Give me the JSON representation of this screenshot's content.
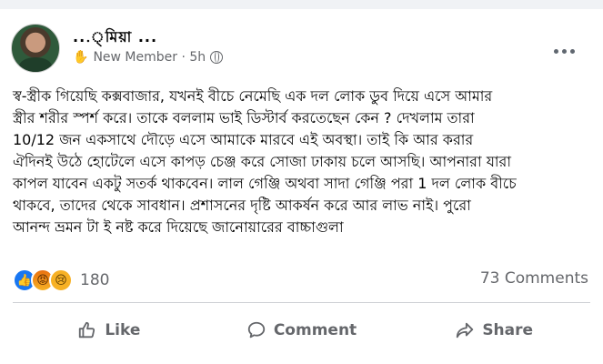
{
  "post": {
    "author_name": "...্মিয়া ...",
    "author_badge": "New Member · 5h",
    "body_lines": [
      "স্ব-স্ত্রীক গিয়েছি কক্সবাজার, যখনই বীচে নেমেছি এক দল লোক ডুব দিয়ে এসে আমার",
      "স্ত্রীর শরীর স্পর্শ করে। তাকে বললাম ভাই ডিস্টার্ব করতেছেন কেন ?  দেখলাম তারা",
      "10/12 জন একসাথে দৌড়ে এসে আমাকে মারবে এই অবস্থা।  তাই কি আর করার",
      "ঐদিনই উঠে হোটেলে এসে কাপড় চেঞ্জ করে সোজা ঢাকায় চলে আসছি। আপনারা যারা",
      "কাপল যাবেন একটু সতর্ক থাকবেন।  লাল গেঞ্জি অথবা সাদা গেঞ্জি পরা 1 দল লোক বীচে",
      "থাকবে,  তাদের থেকে সাবধান। প্রশাসনের দৃষ্টি আকর্ষন করে আর লাভ নাই।  পুরো",
      "আনন্দ ভ্রমন টা ই নষ্ট করে দিয়েছে জানোয়ারের বাচ্চাগুলা"
    ]
  },
  "reactions": {
    "icons": [
      "like-icon",
      "angry-icon",
      "sad-icon"
    ],
    "count": "180"
  },
  "comments_label": "73 Comments",
  "actions": {
    "like": "Like",
    "comment": "Comment",
    "share": "Share"
  },
  "colors": {
    "like_blue": "#1877f2",
    "secondary_text": "#65676b",
    "divider": "#ced0d4"
  }
}
